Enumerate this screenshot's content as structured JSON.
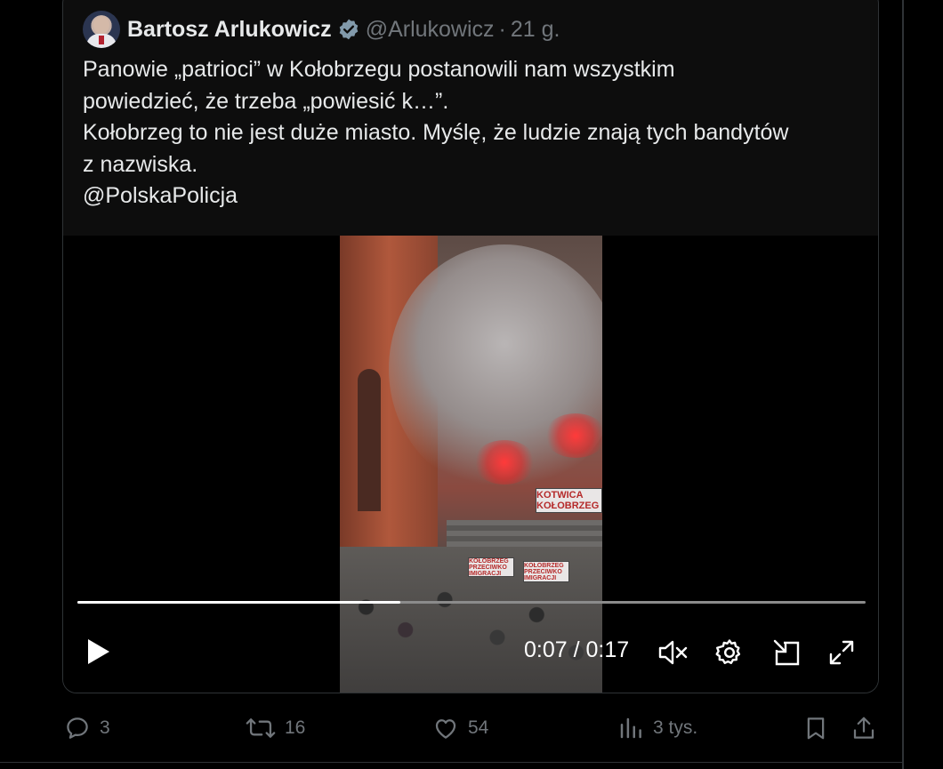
{
  "tweet": {
    "author_name": "Bartosz Arlukowicz",
    "handle": "@Arlukowicz",
    "separator": "·",
    "time": "21 g.",
    "text_lines": [
      "Panowie „patrioci” w Kołobrzegu postanowili nam wszystkim",
      "powiedzieć, że trzeba „powiesić k…”.",
      "Kołobrzeg to nie jest duże miasto. Myślę, że ludzie znają tych bandytów",
      "z nazwiska.",
      "@PolskaPolicja"
    ]
  },
  "video": {
    "time_display": "0:07 / 0:17",
    "progress_fraction": 0.41,
    "banners": [
      "KOTWICA KOŁOBRZEG",
      "KOŁOBRZEG PRZECIWKO IMIGRACJI",
      "KOŁOBRZEG PRZECIWKO IMIGRACJI"
    ]
  },
  "actions": {
    "replies": "3",
    "reposts": "16",
    "likes": "54",
    "views": "3 tys."
  },
  "icons": {
    "verified": "verified-badge-icon",
    "play": "play-icon",
    "mute": "muted-speaker-icon",
    "settings": "gear-icon",
    "pip": "picture-in-picture-icon",
    "fullscreen": "expand-icon",
    "reply": "speech-bubble-icon",
    "repost": "repost-icon",
    "like": "heart-icon",
    "views": "bar-chart-icon",
    "bookmark": "bookmark-icon",
    "share": "share-upload-icon"
  },
  "colors": {
    "background": "#000000",
    "card": "#0d0d0d",
    "border": "#2f3336",
    "text": "#e7e9ea",
    "muted": "#71767b"
  }
}
